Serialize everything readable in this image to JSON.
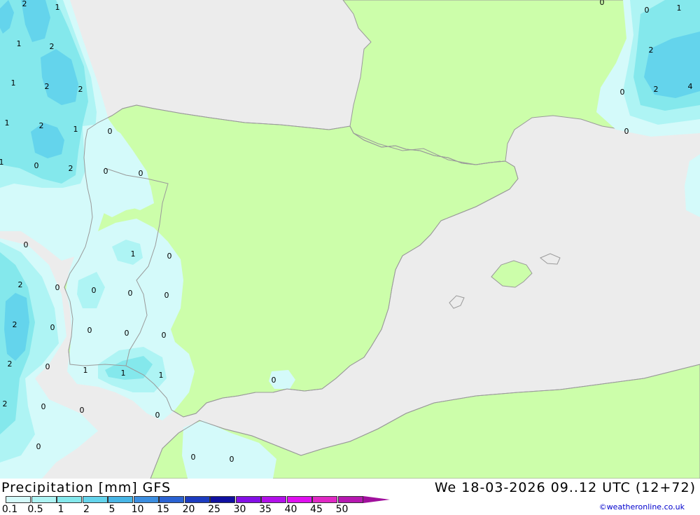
{
  "title": "Precipitation [mm] GFS",
  "valid_time": "We 18-03-2026 09..12 UTC (12+72)",
  "credit": "©weatheronline.co.uk",
  "legend": {
    "ticks": [
      "0.1",
      "0.5",
      "1",
      "2",
      "5",
      "10",
      "15",
      "20",
      "25",
      "30",
      "35",
      "40",
      "45",
      "50"
    ],
    "colors": [
      "#d4fafa",
      "#aef4f4",
      "#84e8ec",
      "#64d4ec",
      "#48b6e6",
      "#3c8ee0",
      "#2a62d2",
      "#1c3cc0",
      "#1010a0",
      "#8410e6",
      "#b210ea",
      "#e010f0",
      "#e028c4",
      "#b618b0"
    ],
    "arrow_color": "#a0109c"
  },
  "map_colors": {
    "sea": "#ececec",
    "land": "#ccfeaa",
    "coast": "#9a9a9a"
  },
  "contour_labels": [
    {
      "text": "2"
    },
    {
      "text": "1"
    },
    {
      "text": "1"
    },
    {
      "text": "2"
    },
    {
      "text": "1"
    },
    {
      "text": "2"
    },
    {
      "text": "2"
    },
    {
      "text": "1"
    },
    {
      "text": "2"
    },
    {
      "text": "1"
    },
    {
      "text": "0"
    },
    {
      "text": "1"
    },
    {
      "text": "0"
    },
    {
      "text": "2"
    },
    {
      "text": "0"
    },
    {
      "text": "0"
    },
    {
      "text": "0"
    },
    {
      "text": "1"
    },
    {
      "text": "0"
    },
    {
      "text": "2"
    },
    {
      "text": "0"
    },
    {
      "text": "0"
    },
    {
      "text": "0"
    },
    {
      "text": "0"
    },
    {
      "text": "2"
    },
    {
      "text": "0"
    },
    {
      "text": "0"
    },
    {
      "text": "0"
    },
    {
      "text": "0"
    },
    {
      "text": "2"
    },
    {
      "text": "0"
    },
    {
      "text": "1"
    },
    {
      "text": "1"
    },
    {
      "text": "1"
    },
    {
      "text": "0"
    },
    {
      "text": "2"
    },
    {
      "text": "0"
    },
    {
      "text": "0"
    },
    {
      "text": "0"
    },
    {
      "text": "0"
    },
    {
      "text": "0"
    },
    {
      "text": "0"
    },
    {
      "text": "0"
    },
    {
      "text": "1"
    },
    {
      "text": "2"
    },
    {
      "text": "0"
    },
    {
      "text": "2"
    },
    {
      "text": "4"
    },
    {
      "text": "0"
    },
    {
      "text": "0"
    }
  ]
}
